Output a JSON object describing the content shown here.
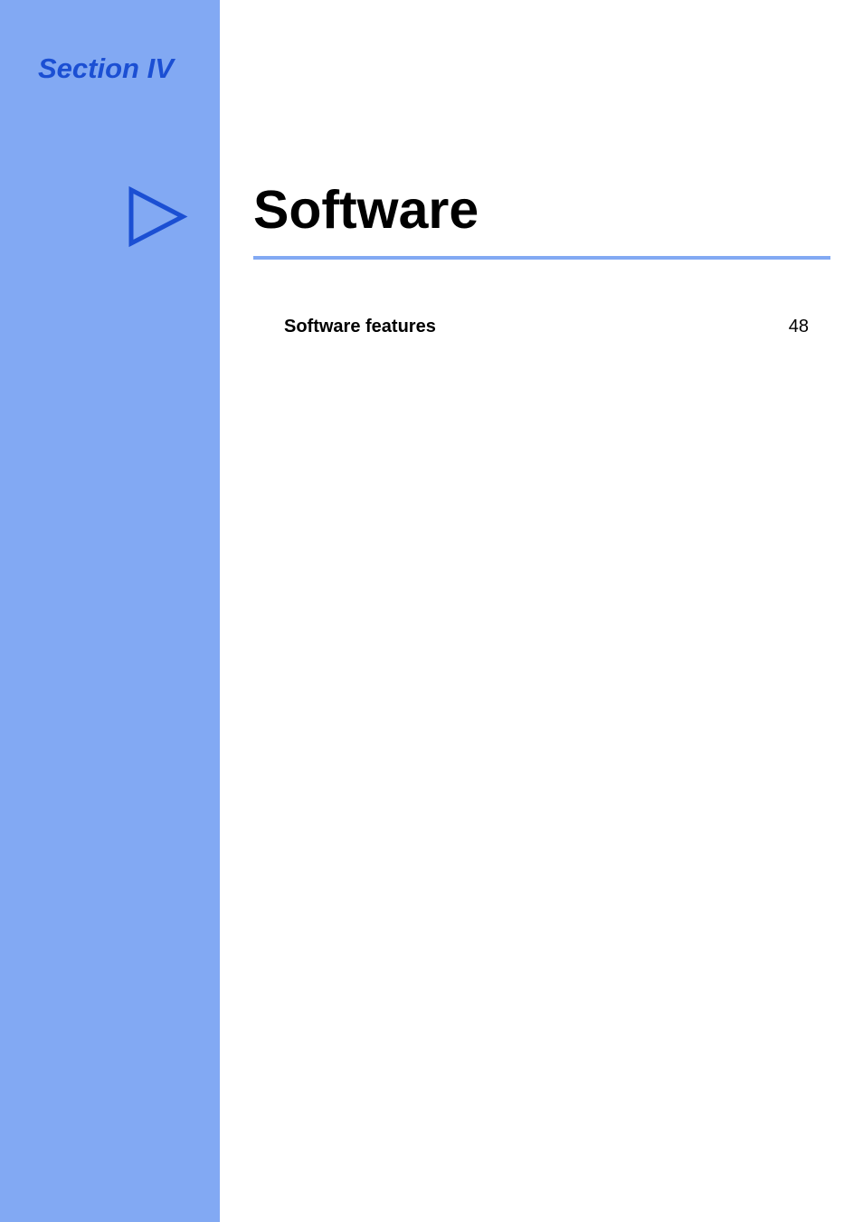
{
  "section": {
    "label": "Section IV"
  },
  "title": "Software",
  "toc": {
    "item1": {
      "label": "Software features",
      "page": "48"
    }
  }
}
